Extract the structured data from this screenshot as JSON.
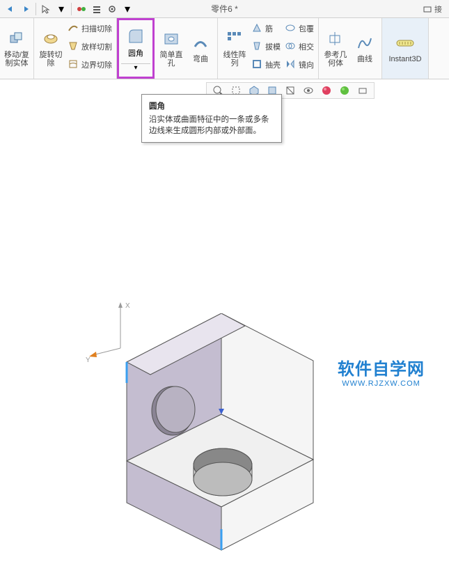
{
  "doc": {
    "title": "零件6 *"
  },
  "topbar": {
    "connect": "接"
  },
  "ribbon": {
    "move_copy": "移动/复\n制实体",
    "rotate_cut": "旋转切\n除",
    "sweep_cut": "扫描切除",
    "loft_cut": "放样切割",
    "boundary_cut": "边界切除",
    "fillet": "圆角",
    "hole": "简单直\n孔",
    "bend": "弯曲",
    "linear_pattern": "线性阵\n列",
    "rib": "筋",
    "draft": "拔模",
    "shell": "抽壳",
    "wrap": "包覆",
    "intersect": "相交",
    "mirror": "镜向",
    "ref_geom": "参考几\n何体",
    "curves": "曲线",
    "instant3d": "Instant3D"
  },
  "tooltip": {
    "title": "圆角",
    "body": "沿实体或曲面特征中的一条或多条边线来生成圆形内部或外部面。"
  },
  "axes": {
    "x": "X",
    "y": "Y"
  },
  "watermark": {
    "main": "软件自学网",
    "sub": "WWW.RJZXW.COM"
  }
}
